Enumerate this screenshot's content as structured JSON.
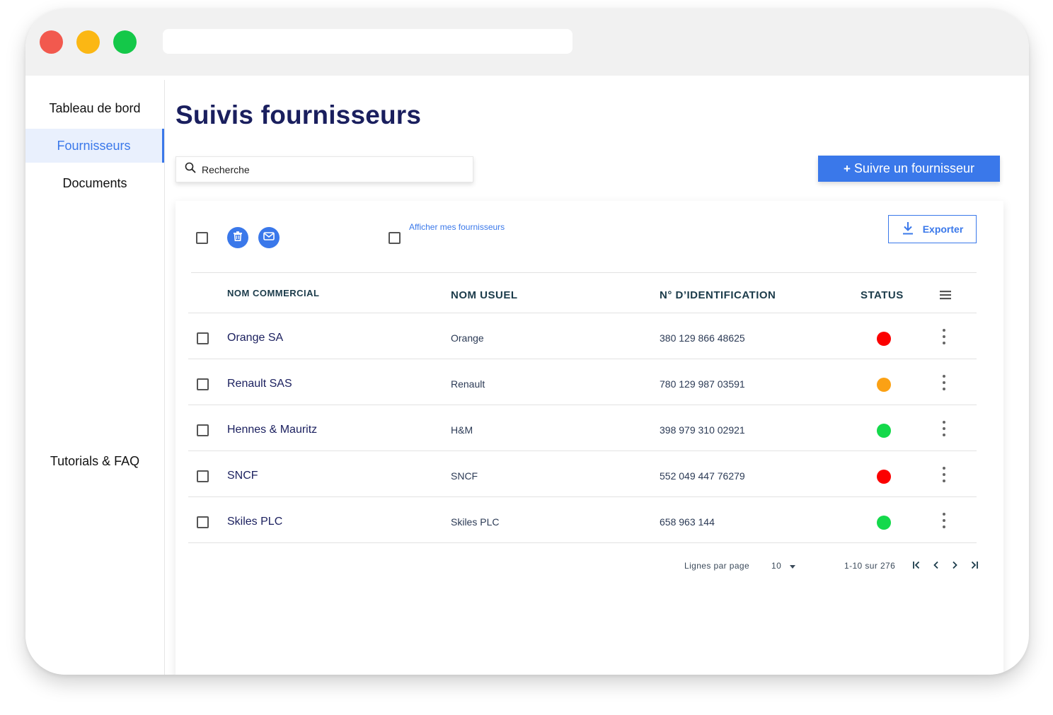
{
  "window": {
    "controls": {
      "close_color": "#f2594e",
      "minimize_color": "#fbb714",
      "maximize_color": "#14c849"
    }
  },
  "sidebar": {
    "items": [
      {
        "label": "Tableau de bord",
        "active": false
      },
      {
        "label": "Fournisseurs",
        "active": true
      },
      {
        "label": "Documents",
        "active": false
      },
      {
        "label": "Tutorials & FAQ",
        "active": false
      }
    ]
  },
  "main": {
    "title": "Suivis fournisseurs",
    "search": {
      "placeholder": "Recherche",
      "icon": "search-icon"
    },
    "follow_button": {
      "plus": "+",
      "label": "Suivre un fournisseur"
    },
    "toolbar": {
      "delete_icon": "trash-icon",
      "mail_icon": "mail-icon",
      "show_mine_label": "Afficher mes fournisseurs",
      "export_label": "Exporter",
      "export_icon": "download-icon"
    },
    "table": {
      "headers": {
        "commercial": "NOM COMMERCIAL",
        "usual": "NOM USUEL",
        "id": "N° D’IDENTIFICATION",
        "status": "STATUS"
      },
      "rows": [
        {
          "commercial": "Orange SA",
          "usual": "Orange",
          "id": "380 129 866 48625",
          "status_color": "#fb0000"
        },
        {
          "commercial": "Renault SAS",
          "usual": "Renault",
          "id": "780 129 987 03591",
          "status_color": "#fba114"
        },
        {
          "commercial": "Hennes & Mauritz",
          "usual": "H&M",
          "id": "398 979 310 02921",
          "status_color": "#14d94b"
        },
        {
          "commercial": "SNCF",
          "usual": "SNCF",
          "id": "552 049 447 76279",
          "status_color": "#fb0000"
        },
        {
          "commercial": "Skiles PLC",
          "usual": "Skiles PLC",
          "id": "658 963 144",
          "status_color": "#14d94b"
        }
      ]
    },
    "pagination": {
      "rows_per_page_label": "Lignes par page",
      "rows_per_page_value": "10",
      "range": "1-10 sur 276"
    }
  },
  "colors": {
    "accent": "#3a78ea",
    "title": "#1a1f5e"
  }
}
